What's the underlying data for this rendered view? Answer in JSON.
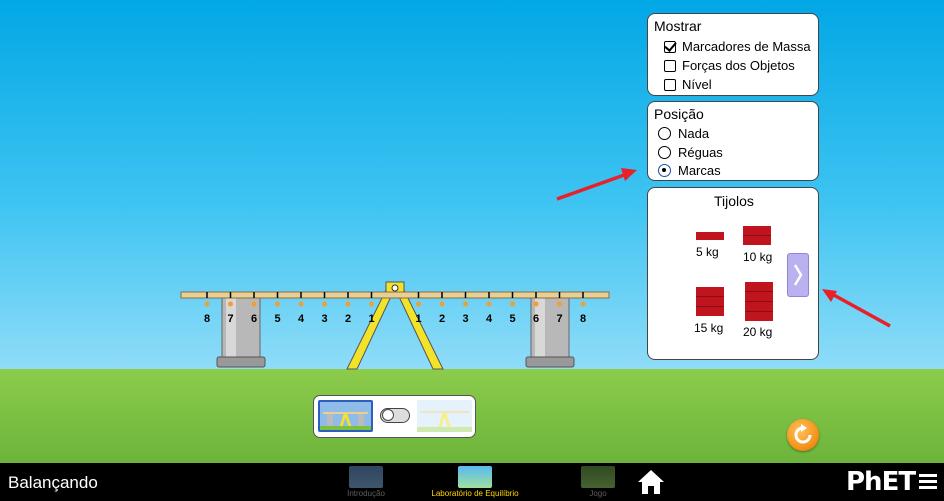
{
  "mostrar": {
    "title": "Mostrar",
    "items": [
      {
        "label": "Marcadores de Massa",
        "checked": true
      },
      {
        "label": "Forças dos Objetos",
        "checked": false
      },
      {
        "label": "Nível",
        "checked": false
      }
    ]
  },
  "posicao": {
    "title": "Posição",
    "options": [
      {
        "label": "Nada",
        "selected": false
      },
      {
        "label": "Réguas",
        "selected": false
      },
      {
        "label": "Marcas",
        "selected": true
      }
    ]
  },
  "tijolos": {
    "title": "Tijolos",
    "bricks": [
      {
        "label": "5 kg"
      },
      {
        "label": "10 kg"
      },
      {
        "label": "15 kg"
      },
      {
        "label": "20 kg"
      }
    ]
  },
  "plank": {
    "left_marks": [
      "8",
      "7",
      "6",
      "5",
      "4",
      "3",
      "2",
      "1"
    ],
    "right_marks": [
      "1",
      "2",
      "3",
      "4",
      "5",
      "6",
      "7",
      "8"
    ]
  },
  "navbar": {
    "sim_title": "Balançando",
    "tabs": [
      {
        "label": "Introdução",
        "active": false
      },
      {
        "label": "Laboratório de Equilíbrio",
        "active": true
      },
      {
        "label": "Jogo",
        "active": false
      }
    ],
    "brand": "PhET"
  },
  "colors": {
    "sky": "#02a7e6",
    "grass": "#7cc042",
    "brick": "#c0141f",
    "active_tab": "#ffd800",
    "next_button": "#b9b1f0",
    "reset_button": "#f7941d",
    "arrow": "#e8202a"
  }
}
